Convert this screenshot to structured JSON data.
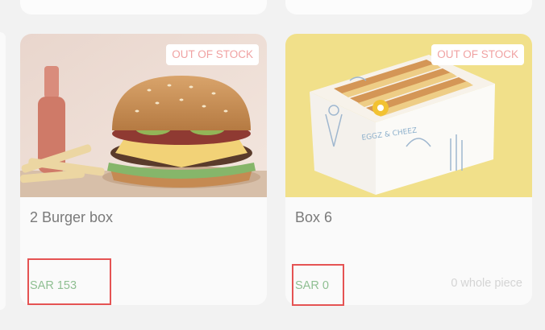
{
  "products": [
    {
      "name": "2 Burger box",
      "badge": "OUT OF STOCK",
      "price": "SAR 153",
      "unit": "",
      "image": "burger",
      "highlighted_price": true
    },
    {
      "name": "Box 6",
      "badge": "OUT OF STOCK",
      "price": "SAR 0",
      "unit": "0 whole piece",
      "image": "sandwich-box",
      "highlighted_price": true
    }
  ],
  "colors": {
    "badge_text": "#f0a2a2",
    "price_text": "#8fbf92",
    "highlight": "#e55353"
  }
}
